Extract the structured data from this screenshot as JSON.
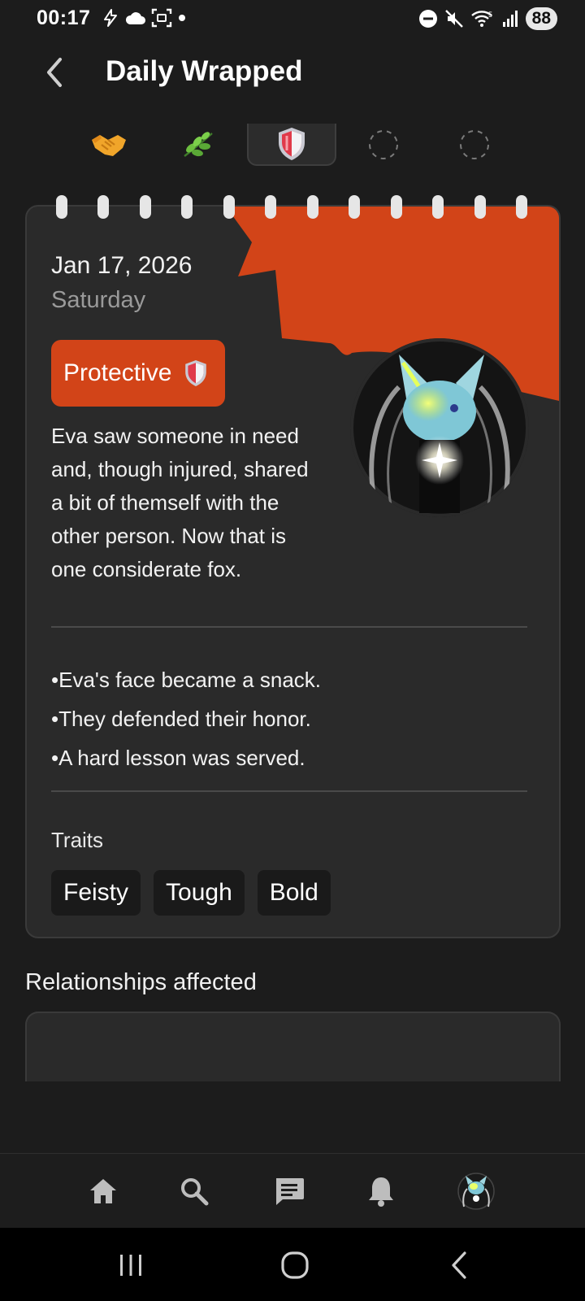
{
  "status_bar": {
    "time": "00:17",
    "battery": "88",
    "left_icons": [
      "flash-icon",
      "cloud-icon",
      "screenshot-icon",
      "dot-icon"
    ],
    "right_icons": [
      "do-not-disturb-icon",
      "muted-icon",
      "wifi-icon",
      "signal-icon"
    ]
  },
  "header": {
    "title": "Daily Wrapped",
    "back_icon": "chevron-left-icon"
  },
  "badge_tabs": [
    {
      "icon": "handshake-icon",
      "active": false
    },
    {
      "icon": "herb-icon",
      "active": false
    },
    {
      "icon": "shield-icon",
      "active": true
    },
    {
      "icon": "empty-slot-icon",
      "active": false
    },
    {
      "icon": "empty-slot-icon",
      "active": false
    }
  ],
  "card": {
    "date": "Jan 17, 2026",
    "weekday": "Saturday",
    "mood": "Protective",
    "mood_icon": "shield-icon",
    "mood_color": "#d24418",
    "accent_color": "#d24418",
    "summary": "Eva saw someone in need and, though injured, shared a bit of themself with the other person. Now that is one considerate fox.",
    "bullets": [
      "•Eva's face became a snack.",
      "•They defended their honor.",
      "•A hard lesson was served."
    ],
    "traits_label": "Traits",
    "traits": [
      "Feisty",
      "Tough",
      "Bold"
    ]
  },
  "relationships": {
    "heading": "Relationships affected"
  },
  "bottom_nav": [
    {
      "icon": "home-icon"
    },
    {
      "icon": "search-icon"
    },
    {
      "icon": "chat-icon"
    },
    {
      "icon": "bell-icon"
    },
    {
      "icon": "profile-avatar"
    }
  ],
  "system_nav": [
    "recent-apps-icon",
    "home-circle-icon",
    "back-icon"
  ]
}
